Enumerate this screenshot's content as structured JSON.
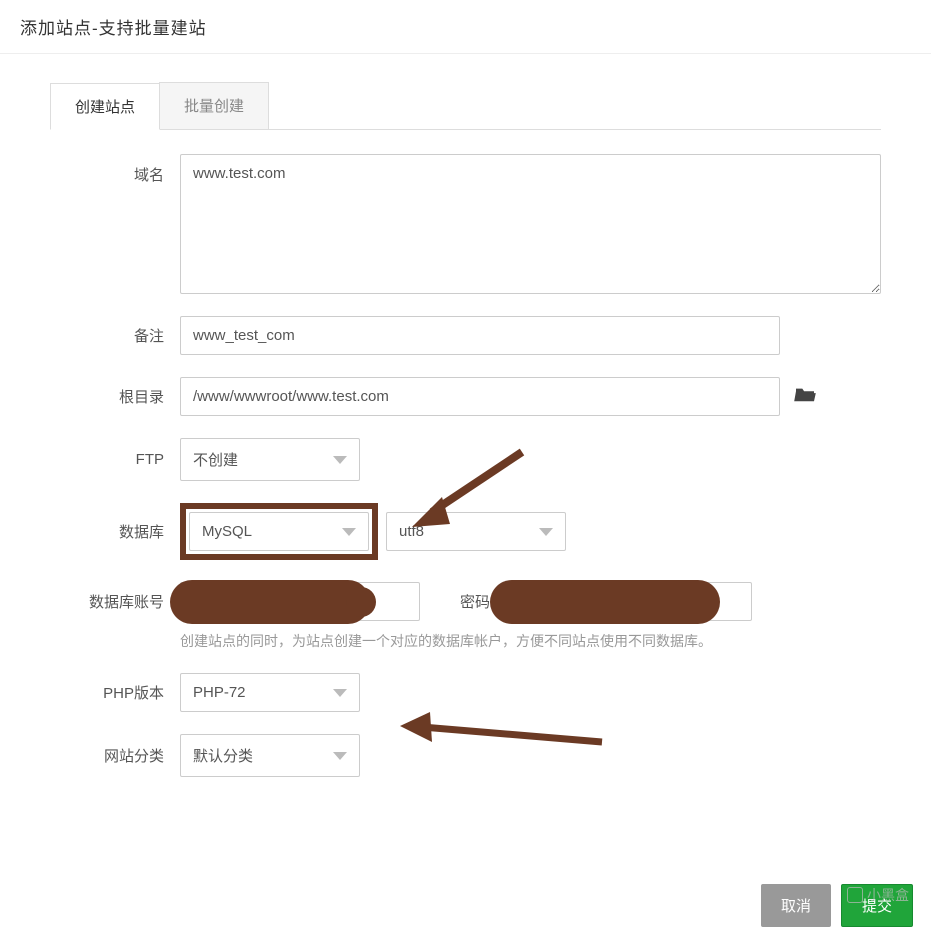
{
  "modal_title": "添加站点-支持批量建站",
  "tabs": {
    "create": "创建站点",
    "batch": "批量创建"
  },
  "labels": {
    "domain": "域名",
    "remark": "备注",
    "root": "根目录",
    "ftp": "FTP",
    "database": "数据库",
    "db_account": "数据库账号",
    "password": "密码",
    "php_version": "PHP版本",
    "site_category": "网站分类"
  },
  "values": {
    "domain": "www.test.com",
    "remark": "www_test_com",
    "root": "/www/wwwroot/www.test.com",
    "ftp": "不创建",
    "database": "MySQL",
    "charset": "utf8",
    "php_version": "PHP-72",
    "site_category": "默认分类"
  },
  "help": {
    "db_account": "创建站点的同时，为站点创建一个对应的数据库帐户，方便不同站点使用不同数据库。"
  },
  "buttons": {
    "cancel": "取消",
    "submit": "提交"
  },
  "watermark": "小黑盒"
}
